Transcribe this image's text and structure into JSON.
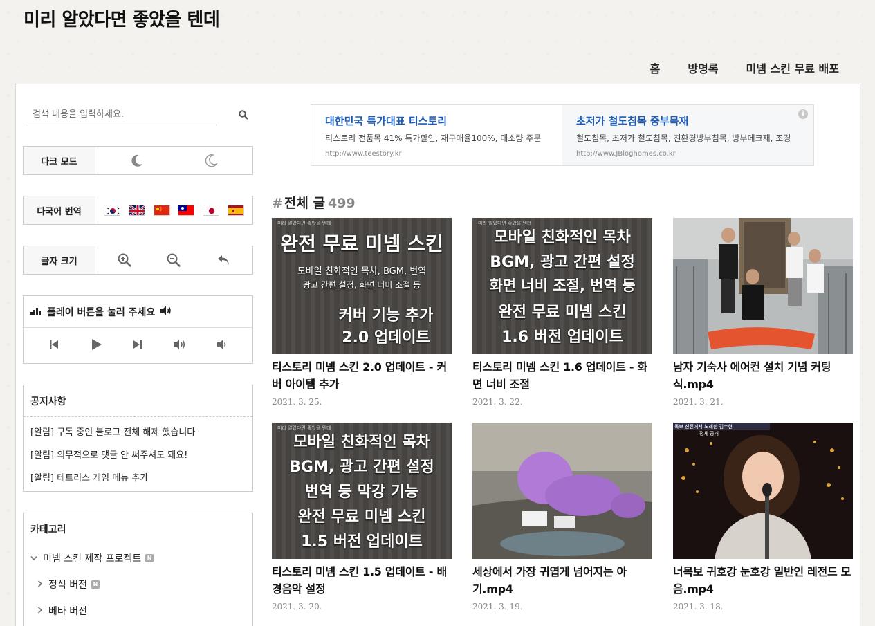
{
  "blog": {
    "title": "미리 알았다면 좋았을 텐데"
  },
  "nav": [
    "홈",
    "방명록",
    "미넴 스킨 무료 배포"
  ],
  "search": {
    "placeholder": "검색 내용을 입력하세요."
  },
  "dark_mode": {
    "label": "다크 모드"
  },
  "translate": {
    "label": "다국어 번역",
    "flags": [
      "korea-flag",
      "uk-flag",
      "china-flag",
      "taiwan-flag",
      "japan-flag",
      "spain-flag"
    ]
  },
  "font_size": {
    "label": "글자 크기"
  },
  "player": {
    "prompt": "플레이 버튼을 눌러 주세요"
  },
  "notice": {
    "title": "공지사항",
    "items": [
      "[알림] 구독 중인 블로그 전체 해제 했습니다",
      "[알림] 의무적으로 댓글 안 써주셔도 돼요!",
      "[알림] 테트리스 게임 메뉴 추가"
    ]
  },
  "category": {
    "title": "카테고리",
    "items": [
      {
        "label": "미넴 스킨 제작 프로젝트",
        "badge": "N"
      },
      {
        "label": "정식 버전",
        "badge": "N"
      },
      {
        "label": "베타 버전",
        "badge": ""
      }
    ]
  },
  "ads": [
    {
      "title": "대한민국 특가대표 티스토리",
      "desc": "티스토리 전품목 41% 특가할인, 재구매율100%, 대소량 주문",
      "url": "http://www.teestory.kr"
    },
    {
      "title": "초저가 철도침목 중부목재",
      "desc": "철도침목, 초저가 철도침목, 친환경방부침목, 방부데크재, 조경",
      "url": "http://www.JBloghomes.co.kr"
    }
  ],
  "ad_info": "i",
  "section": {
    "hash": "#",
    "title": "전체 글",
    "count": "499"
  },
  "posts": [
    {
      "title": "티스토리 미넴 스킨 2.0 업데이트 - 커버 아이템 추가",
      "date": "2021. 3. 25.",
      "thumb": {
        "mini": "미리 알았다면 좋았을 텐데",
        "big": "완전 무료 미넴 스킨",
        "small1": "모바일 친화적인 목차, BGM, 번역",
        "small2": "광고 간편 설정, 화면 너비 조절 등",
        "line3": "커버 기능 추가",
        "line4": "2.0 업데이트"
      }
    },
    {
      "title": "티스토리 미넴 스킨 1.6 업데이트 - 화면 너비 조절",
      "date": "2021. 3. 22.",
      "thumb": {
        "mini": "미리 알았다면 좋았을 텐데",
        "lines": [
          "모바일 친화적인 목차",
          "BGM, 광고 간편 설정",
          "화면 너비 조절, 번역 등",
          "완전 무료 미넴 스킨",
          "1.6 버전 업데이트"
        ]
      }
    },
    {
      "title": "남자 기숙사 에어컨 설치 기념 커팅식.mp4",
      "date": "2021. 3. 21."
    },
    {
      "title": "티스토리 미넴 스킨 1.5 업데이트 - 배경음악 설정",
      "date": "2021. 3. 20.",
      "thumb": {
        "mini": "미리 알았다면 좋았을 텐데",
        "lines": [
          "모바일 친화적인 목차",
          "BGM, 광고 간편 설정",
          "번역 등 막강 기능",
          "완전 무료 미넴 스킨",
          "1.5 버전 업데이트"
        ]
      }
    },
    {
      "title": "세상에서 가장 귀엽게 넘어지는 아기.mp4",
      "date": "2021. 3. 19."
    },
    {
      "title": "너목보 귀호강 눈호강 일반인 레전드 모음.mp4",
      "date": "2021. 3. 18.",
      "thumb": {
        "caption1": "목보 신진에서 노래한 김수현",
        "caption2": "정체 공개"
      }
    }
  ]
}
